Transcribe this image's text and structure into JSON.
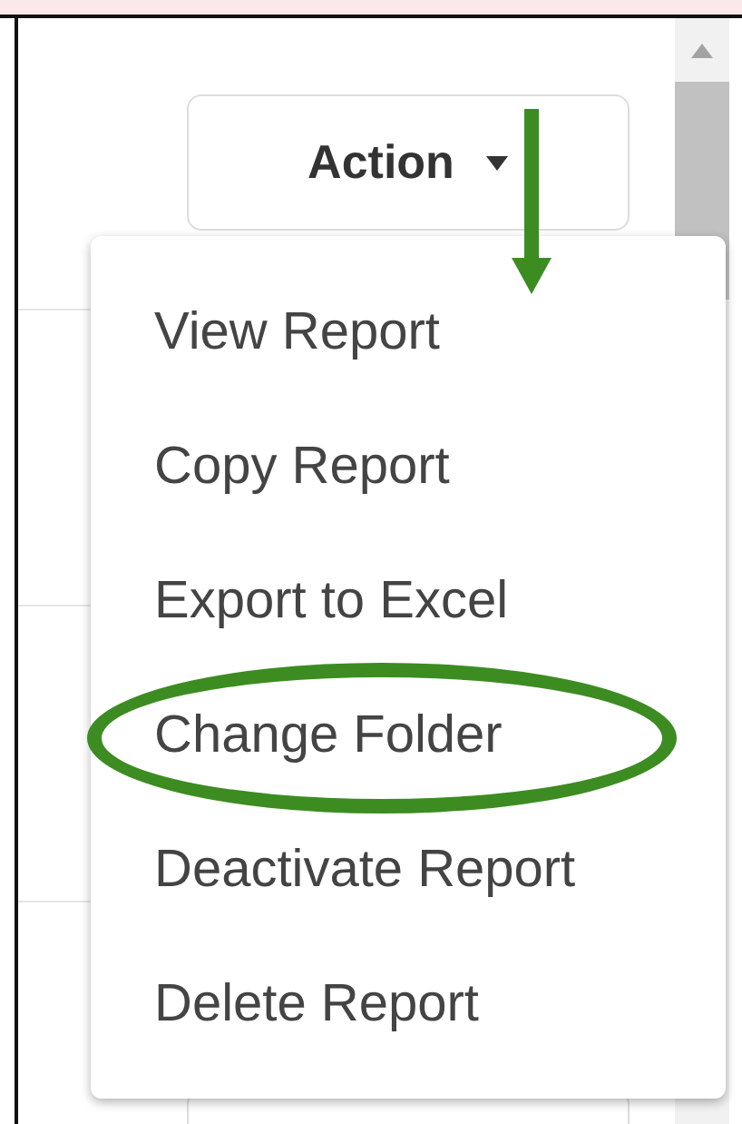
{
  "action_button": {
    "label": "Action"
  },
  "menu": {
    "items": [
      {
        "label": "View Report",
        "highlighted": false
      },
      {
        "label": "Copy Report",
        "highlighted": false
      },
      {
        "label": "Export to Excel",
        "highlighted": false
      },
      {
        "label": "Change Folder",
        "highlighted": true
      },
      {
        "label": "Deactivate Report",
        "highlighted": false
      },
      {
        "label": "Delete Report",
        "highlighted": false
      }
    ]
  }
}
